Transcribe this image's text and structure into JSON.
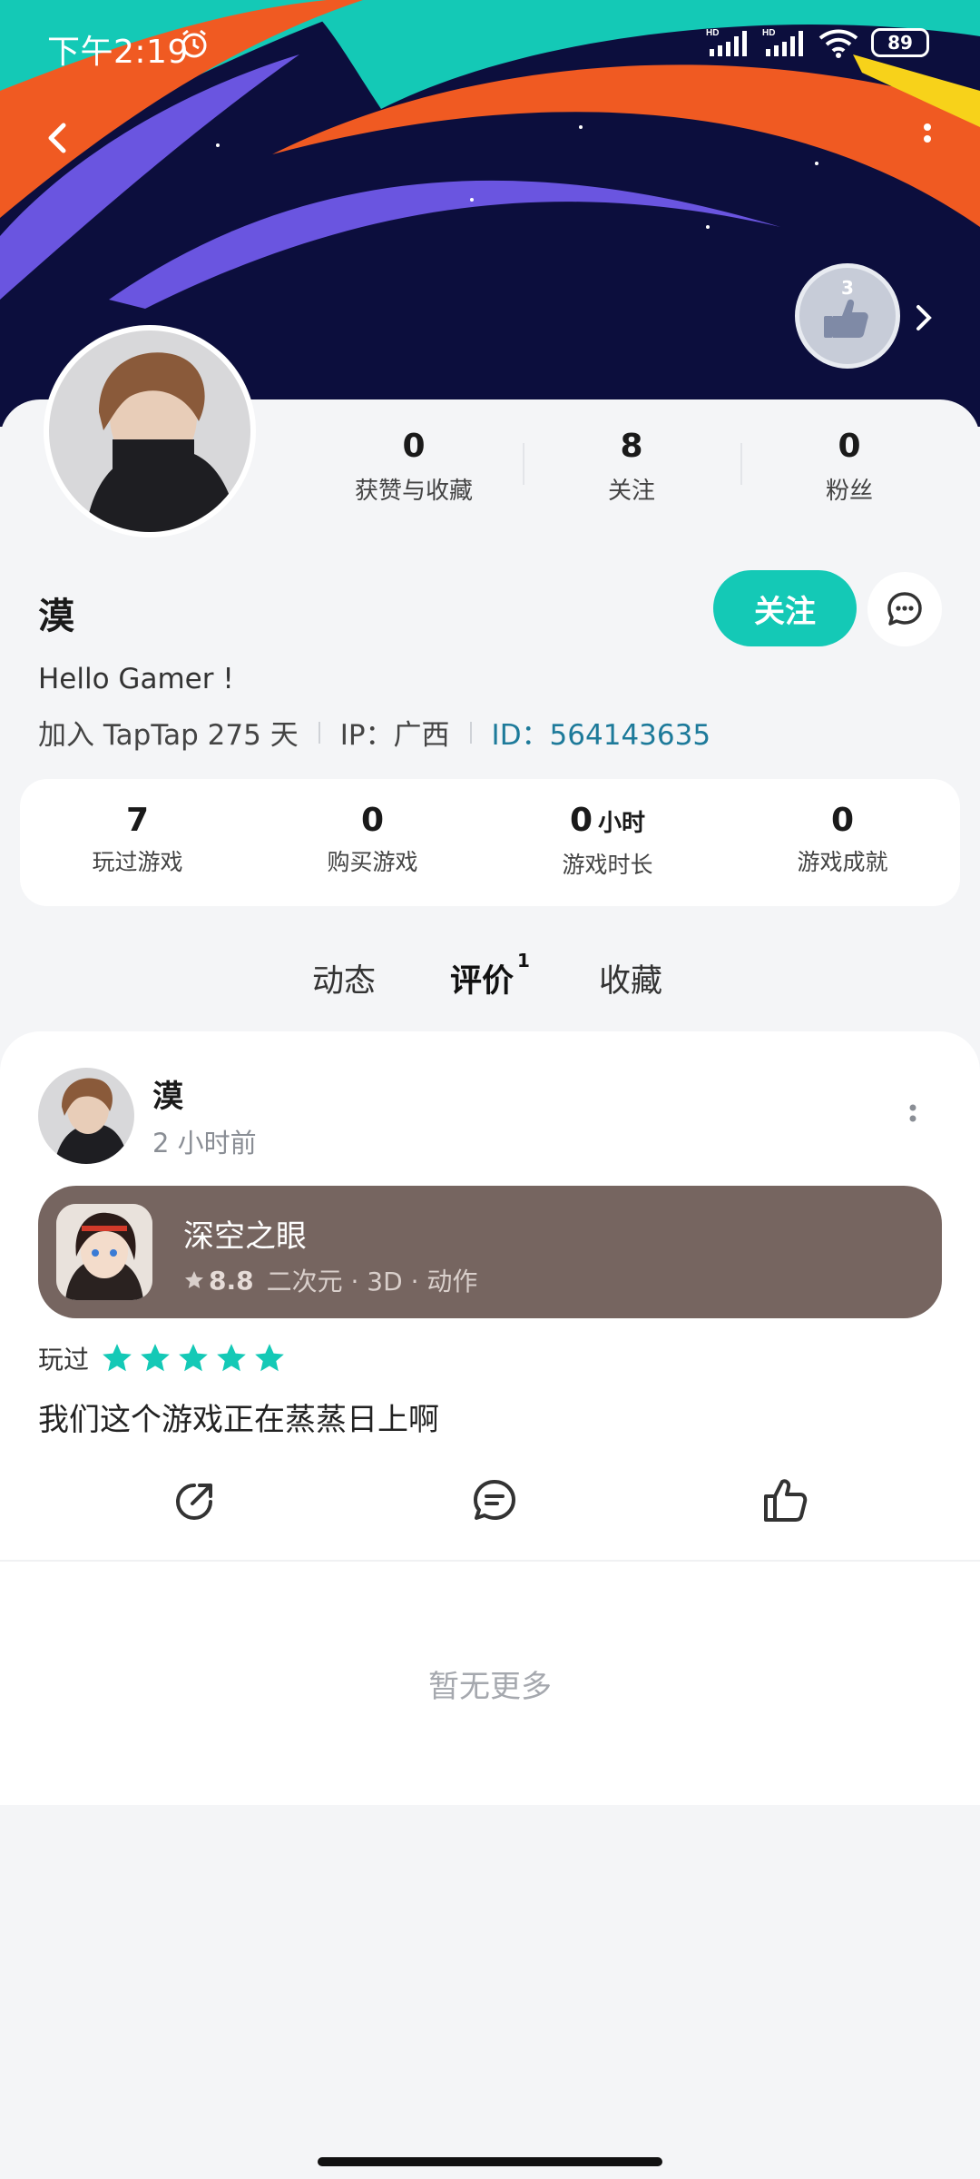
{
  "status_bar": {
    "time": "下午2:19",
    "battery": "89"
  },
  "profile": {
    "username": "漠",
    "bio": "Hello Gamer !",
    "join_text": "加入 TapTap 275 天",
    "ip_text": "IP：广西",
    "id_text": "ID：564143635",
    "badge_level": "3",
    "follow_label": "关注",
    "stats": [
      {
        "num": "0",
        "label": "获赞与收藏"
      },
      {
        "num": "8",
        "label": "关注"
      },
      {
        "num": "0",
        "label": "粉丝"
      }
    ]
  },
  "game_stats": [
    {
      "num": "7",
      "unit": "",
      "label": "玩过游戏"
    },
    {
      "num": "0",
      "unit": "",
      "label": "购买游戏"
    },
    {
      "num": "0",
      "unit": "小时",
      "label": "游戏时长"
    },
    {
      "num": "0",
      "unit": "",
      "label": "游戏成就"
    }
  ],
  "tabs": [
    {
      "label": "动态"
    },
    {
      "label": "评价",
      "count": "1",
      "active": true
    },
    {
      "label": "收藏"
    }
  ],
  "review": {
    "author": "漠",
    "time": "2 小时前",
    "game": {
      "title": "深空之眼",
      "score": "8.8",
      "tags": "二次元 · 3D · 动作"
    },
    "played_label": "玩过",
    "rating": 5,
    "text": "我们这个游戏正在蒸蒸日上啊"
  },
  "footer": {
    "no_more": "暂无更多"
  },
  "colors": {
    "accent": "#14c9b6",
    "game_card": "#766560",
    "id_link": "#1d7a9a"
  }
}
